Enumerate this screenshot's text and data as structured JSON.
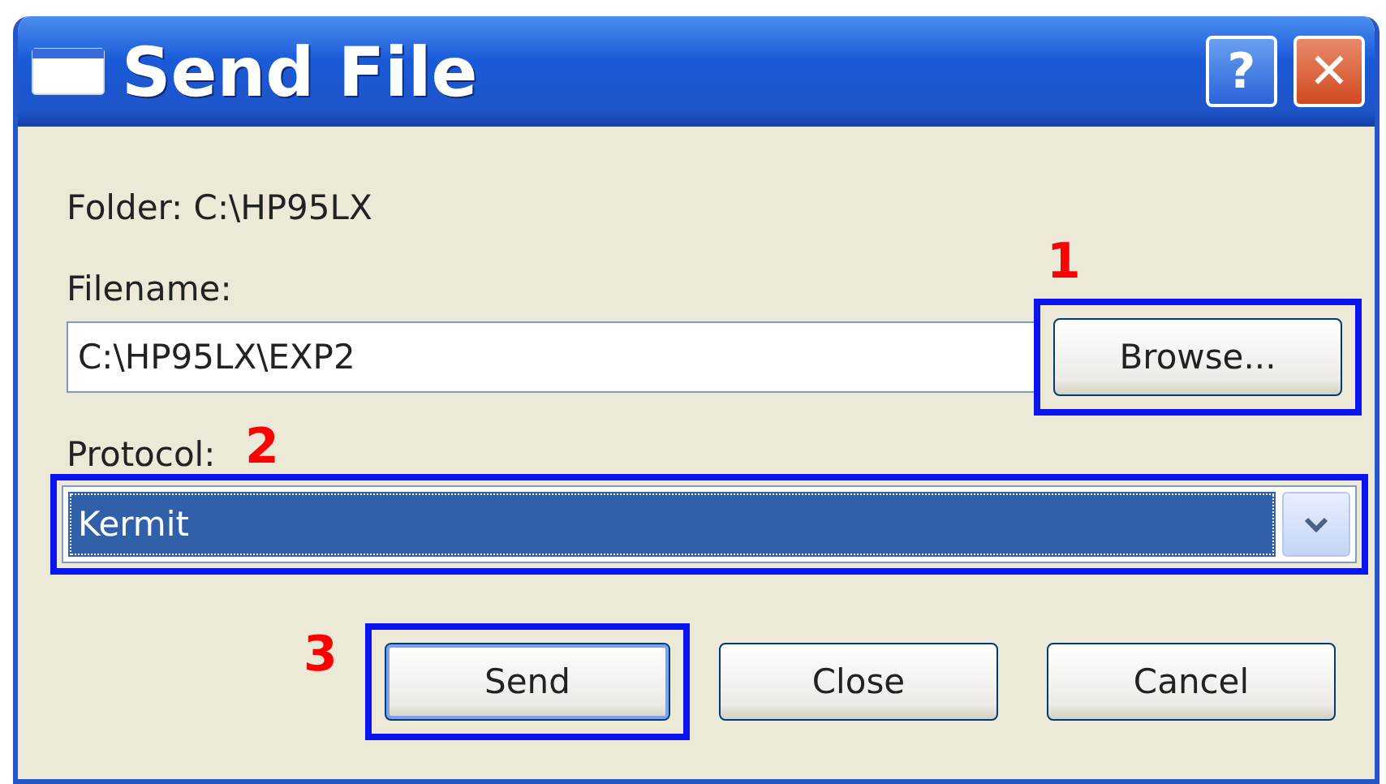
{
  "window": {
    "title": "Send File",
    "buttons": [
      {
        "kind": "help",
        "label": "?"
      },
      {
        "kind": "close",
        "label": "✕"
      }
    ]
  },
  "folder": "Folder: C:\\HP95LX",
  "filename": {
    "label": "Filename:",
    "value": "C:\\HP95LX\\EXP2",
    "button": "Browse...",
    "callout": "1"
  },
  "protocol": {
    "label": "Protocol:",
    "value": "Kermit",
    "callout": "2"
  },
  "buttons": [
    {
      "label": "Send",
      "default": true,
      "callout": "3"
    },
    {
      "label": "Close",
      "default": false
    },
    {
      "label": "Cancel",
      "default": false
    }
  ]
}
